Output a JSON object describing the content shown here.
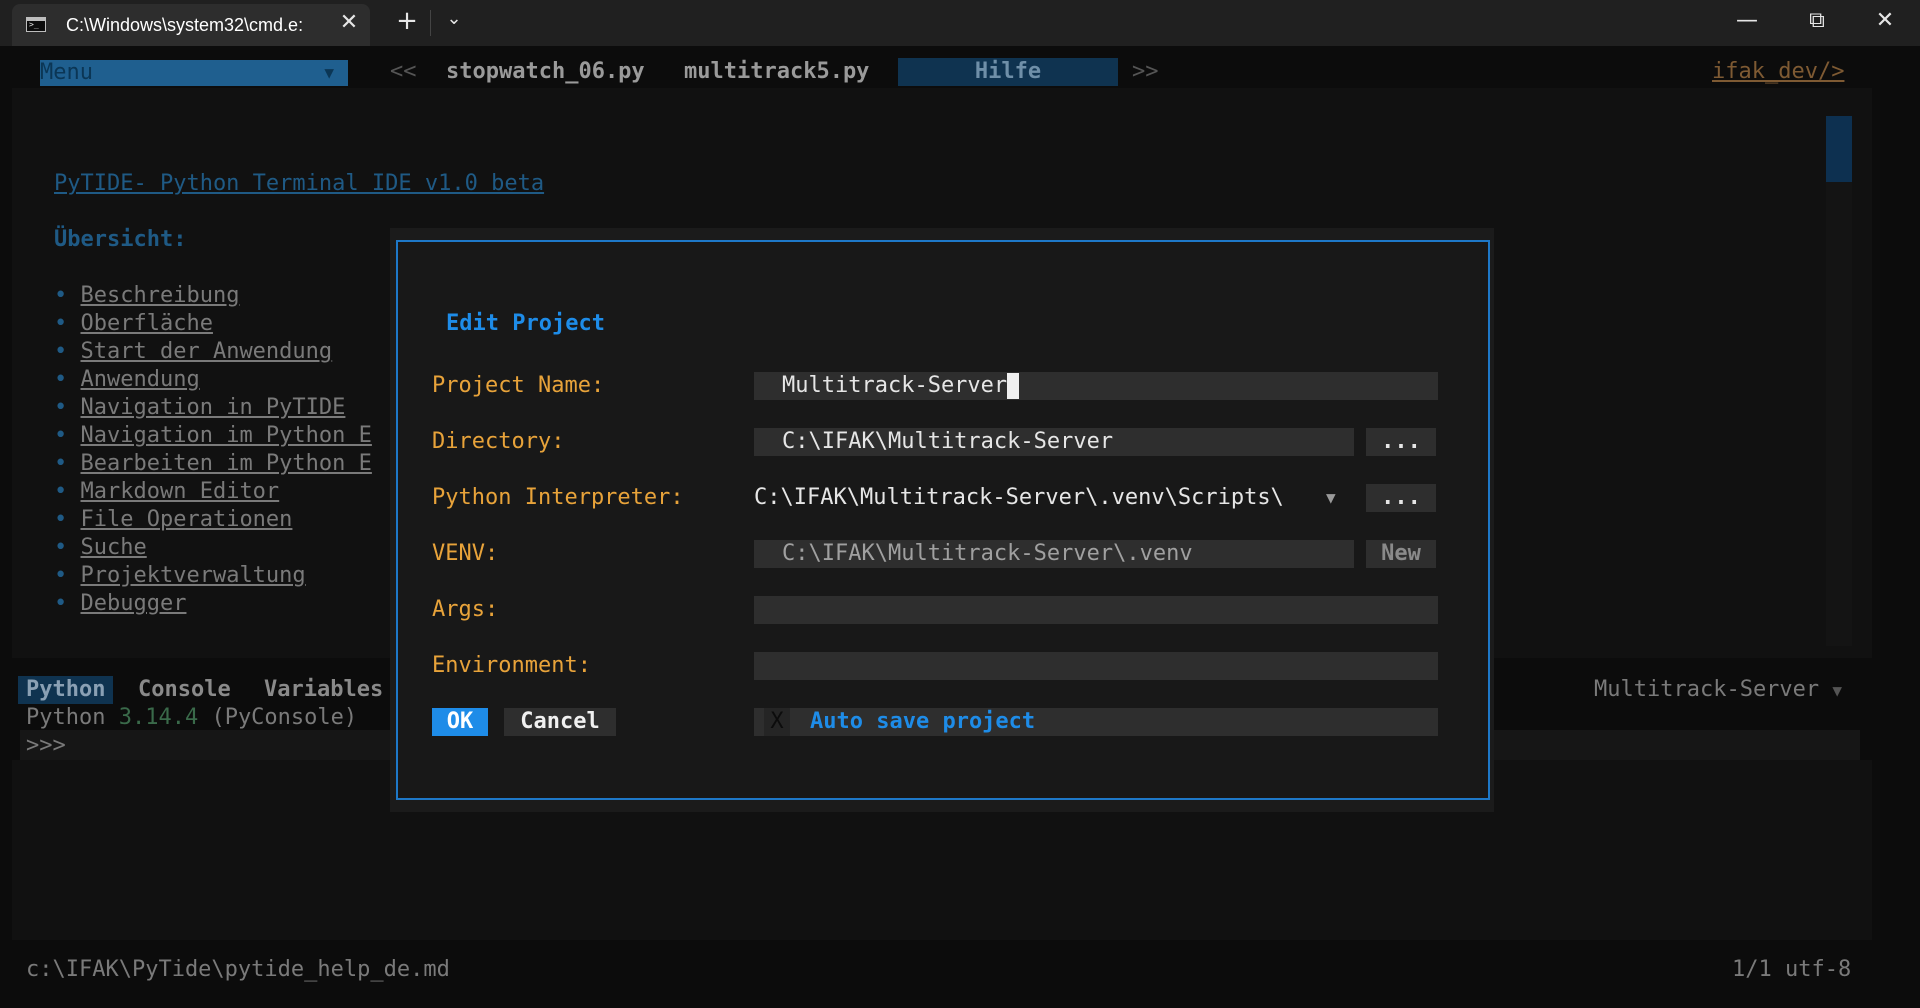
{
  "window": {
    "tab_title": "C:\\Windows\\system32\\cmd.e:",
    "close_tab": "✕",
    "new_tab": "+",
    "tab_dropdown": "⌄",
    "minimize": "—",
    "maximize": "⧉",
    "close": "✕"
  },
  "editor_tabs": {
    "menu_label": "Menu",
    "menu_arrow": "▼",
    "scroll_left": "<<",
    "files": [
      "stopwatch_06.py",
      "multitrack5.py"
    ],
    "active": "Hilfe",
    "scroll_right": ">>",
    "user_link": "ifak_dev/>"
  },
  "help": {
    "title": "PyTIDE- Python Terminal IDE v1.0 beta",
    "overview": "Übersicht:",
    "items": [
      "Beschreibung",
      "Oberfläche",
      "Start der Anwendung",
      "Anwendung",
      "Navigation in PyTIDE",
      "Navigation im Python E",
      "Bearbeiten im Python E",
      "Markdown Editor",
      "File Operationen",
      "Suche",
      "Projektverwaltung",
      "Debugger"
    ]
  },
  "bottom_panel": {
    "tabs": [
      "Python",
      "Console",
      "Variables"
    ],
    "project": "Multitrack-Server",
    "project_arrow": "▼",
    "python_prefix": "Python ",
    "python_version": "3.14.4",
    "python_suffix": " (PyConsole)",
    "prompt": ">>>"
  },
  "status": {
    "path": "c:\\IFAK\\PyTide\\pytide_help_de.md",
    "position": "1/1 utf-8"
  },
  "dialog": {
    "title": "Edit Project",
    "labels": {
      "project_name": "Project Name:",
      "directory": "Directory:",
      "interpreter": "Python Interpreter:",
      "venv": "VENV:",
      "args": "Args:",
      "environment": "Environment:"
    },
    "values": {
      "project_name": "Multitrack-Server",
      "directory": "C:\\IFAK\\Multitrack-Server",
      "interpreter": "C:\\IFAK\\Multitrack-Server\\.venv\\Scripts\\",
      "venv": "C:\\IFAK\\Multitrack-Server\\.venv",
      "args": "",
      "environment": ""
    },
    "interp_arrow": "▼",
    "browse": "...",
    "new_venv": "New",
    "ok": "OK",
    "cancel": "Cancel",
    "autosave_check": "X",
    "autosave_label": "Auto save project"
  }
}
